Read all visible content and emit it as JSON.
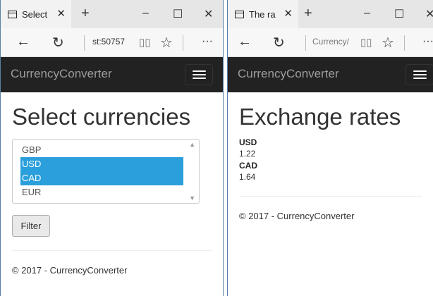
{
  "left": {
    "tab_title": "Select",
    "address": "st:50757",
    "brand": "CurrencyConverter",
    "heading": "Select currencies",
    "options": [
      {
        "label": "GBP",
        "selected": false
      },
      {
        "label": "USD",
        "selected": true
      },
      {
        "label": "CAD",
        "selected": true
      },
      {
        "label": "EUR",
        "selected": false
      }
    ],
    "filter_label": "Filter",
    "footer": "© 2017 - CurrencyConverter"
  },
  "right": {
    "tab_title": "The ra",
    "address": "Currency/",
    "brand": "CurrencyConverter",
    "heading": "Exchange rates",
    "rates": [
      {
        "currency": "USD",
        "value": "1.22"
      },
      {
        "currency": "CAD",
        "value": "1.64"
      }
    ],
    "footer": "© 2017 - CurrencyConverter"
  },
  "chrome": {
    "tab_close": "✕",
    "new_tab": "+",
    "minimize": "–",
    "maximize": "☐",
    "close": "✕",
    "back": "←",
    "refresh": "↻",
    "reading": "▯▯",
    "favorite": "☆",
    "more": "···"
  },
  "colors": {
    "navbar": "#222222",
    "selection": "#2a9fdb"
  }
}
